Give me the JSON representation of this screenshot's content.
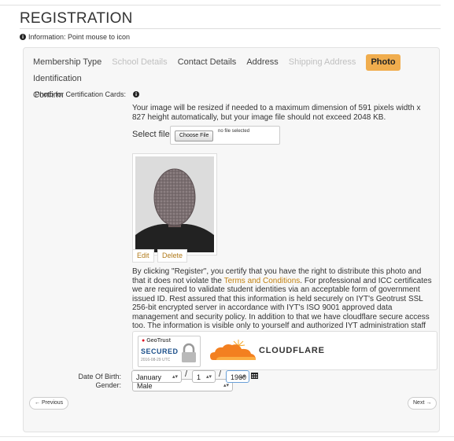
{
  "page": {
    "title": "REGISTRATION"
  },
  "info": {
    "icon": "info-circle-icon",
    "text": "Information: Point mouse to icon"
  },
  "tabs": [
    {
      "label": "Membership Type",
      "state": "normal"
    },
    {
      "label": "School Details",
      "state": "disabled"
    },
    {
      "label": "Contact Details",
      "state": "normal"
    },
    {
      "label": "Address",
      "state": "normal"
    },
    {
      "label": "Shipping Address",
      "state": "disabled"
    },
    {
      "label": "Photo",
      "state": "active"
    },
    {
      "label": "Identification",
      "state": "normal"
    },
    {
      "label": "Confirm",
      "state": "normal"
    }
  ],
  "photo_section": {
    "label": "Photo for Certification Cards:",
    "resize_notice": "Your image will be resized if needed to a maximum dimension of 591 pixels width x 827 height automatically, but your image file should not exceed 2048 KB.",
    "select_file_label": "Select file",
    "choose_file_button": "Choose File",
    "file_status": "no file selected",
    "edit_button": "Edit",
    "delete_button": "Delete",
    "certify_text_before": "By clicking \"Register\", you certify that you have the right to distribute this photo and that it does not violate the ",
    "terms_link": "Terms and Conditions",
    "certify_text_after": ". For professional and ICC certificates we are required to validate student identities via an acceptable form of government issued ID. Rest assured that this information is held securely on IYT's Geotrust SSL 256-bit encrypted server in accordance with IYT's ISO 9001 approved data management and security policy. In addition to that we have cloudflare secure access too. The information is visible only to yourself and authorized IYT administration staff"
  },
  "badges": {
    "geotrust_brand": "GeoTrust",
    "geotrust_secured": "SECURED",
    "geotrust_date": "2016-08-29 UTC",
    "cloudflare": "CLOUDFLARE"
  },
  "gender": {
    "label": "Gender:",
    "value": "Male"
  },
  "dob": {
    "label": "Date Of Birth:",
    "month": "January",
    "day": "1",
    "year": "1960"
  },
  "nav": {
    "previous": "← Previous",
    "next": "Next →"
  },
  "colors": {
    "accent": "#f0ad4e",
    "link": "#c08010",
    "panel_bg": "#f7f7f7"
  }
}
